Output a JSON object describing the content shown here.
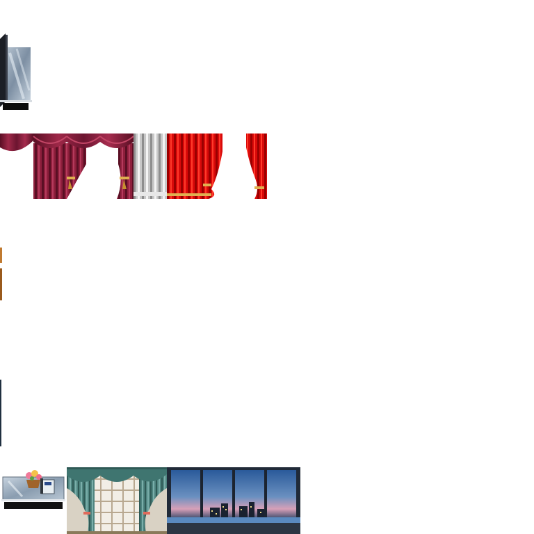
{
  "tileset": {
    "colors": {
      "background": "#ffffff",
      "burgundy_curtain": "#8e1f3c",
      "burgundy_dark": "#5a0f24",
      "silver_curtain": "#c9c9c9",
      "red_curtain": "#d90a0a",
      "gold_trim": "#e0b050",
      "teal_curtain": "#4f8580",
      "glass_panel": "#a9b9c8",
      "night_sky": "#2a4f7a",
      "dusk_glow": "#d8a0b8"
    },
    "tiles": [
      {
        "name": "glass-partition",
        "icon": "glass-partition-icon"
      },
      {
        "name": "burgundy-valance-left",
        "icon": "curtain-valance-icon"
      },
      {
        "name": "burgundy-curtain-center",
        "icon": "curtain-tied-icon"
      },
      {
        "name": "burgundy-curtain-right",
        "icon": "curtain-tied-icon"
      },
      {
        "name": "silver-curtain",
        "icon": "curtain-straight-icon"
      },
      {
        "name": "red-curtain",
        "icon": "curtain-tied-icon"
      },
      {
        "name": "red-curtain-side",
        "icon": "curtain-tied-icon"
      },
      {
        "name": "wood-edge",
        "icon": "wood-strip-icon"
      },
      {
        "name": "dark-edge",
        "icon": "dark-strip-icon"
      },
      {
        "name": "reception-desk-flowers-phone",
        "icon": "desk-phone-flower-icon"
      },
      {
        "name": "window-with-teal-curtains",
        "icon": "window-curtain-icon"
      },
      {
        "name": "city-night-window",
        "icon": "city-window-icon"
      }
    ]
  }
}
